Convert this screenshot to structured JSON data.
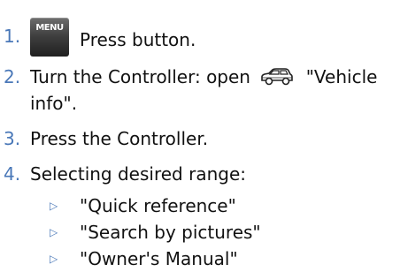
{
  "steps": [
    {
      "number": "1.",
      "icon": "menu-button-icon",
      "icon_label": "MENU",
      "text": "Press button."
    },
    {
      "number": "2.",
      "text_before": "Turn the Controller: open",
      "icon": "vehicle-car-icon",
      "text_after": "\"Vehicle",
      "text_line2": "info\"."
    },
    {
      "number": "3.",
      "text": "Press the Controller."
    },
    {
      "number": "4.",
      "text": "Selecting desired range:"
    }
  ],
  "options": [
    {
      "bullet": "▷",
      "label": "\"Quick reference\""
    },
    {
      "bullet": "▷",
      "label": "\"Search by pictures\""
    },
    {
      "bullet": "▷",
      "label": "\"Owner's Manual\""
    }
  ],
  "colors": {
    "step_number": "#4a78b8",
    "text": "#111111",
    "menu_icon_bg": "#3a3a3a"
  }
}
